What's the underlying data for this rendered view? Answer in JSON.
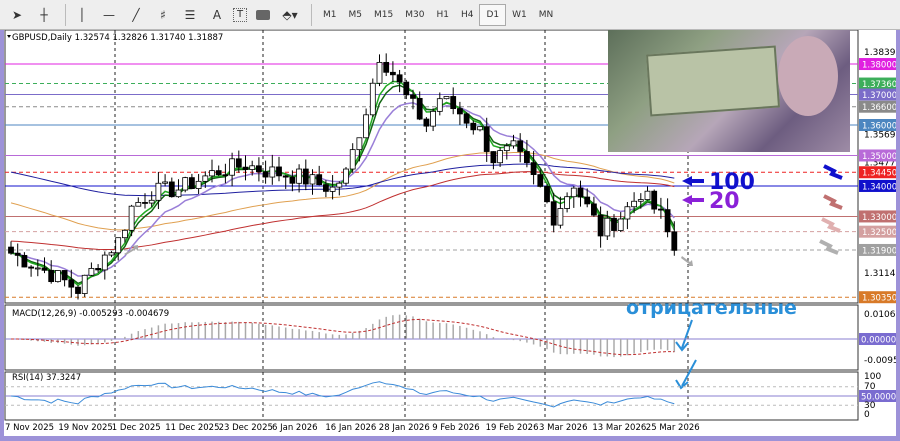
{
  "toolbar": {
    "tools": [
      "cursor-icon",
      "crosshair-icon",
      "vertical-line-icon",
      "horizontal-line-icon",
      "trendline-icon",
      "fibo-icon",
      "channel-icon",
      "text-icon",
      "text-label-icon",
      "rectangle-icon",
      "shapes-icon"
    ],
    "text_tool": "A",
    "text_label_tool": "T",
    "timeframes": [
      "M1",
      "M5",
      "M15",
      "M30",
      "H1",
      "H4",
      "D1",
      "W1",
      "MN"
    ],
    "active_timeframe": "D1"
  },
  "chart": {
    "symbol_header": "GBPUSD,Daily  1.32574 1.32826 1.31740 1.31887",
    "price_labels": [
      {
        "text": "1.38395",
        "p": 1.38395
      },
      {
        "text": "1.35695",
        "p": 1.35695
      },
      {
        "text": "1.34770",
        "p": 1.3477
      },
      {
        "text": "1.31145",
        "p": 1.31145
      }
    ],
    "levels": [
      {
        "text": "1.38000",
        "p": 1.38,
        "color": "#e020e0",
        "style": "solid"
      },
      {
        "text": "1.37360",
        "p": 1.3736,
        "color": "#3cae5a",
        "style": "dash"
      },
      {
        "text": "1.37000",
        "p": 1.37,
        "color": "#7b6cc9",
        "style": "solid"
      },
      {
        "text": "1.36600",
        "p": 1.366,
        "color": "#8a8a8a",
        "style": "dash"
      },
      {
        "text": "1.36000",
        "p": 1.36,
        "color": "#4c86c0",
        "style": "solid"
      },
      {
        "text": "1.35000",
        "p": 1.35,
        "color": "#b86ad8",
        "style": "solid"
      },
      {
        "text": "1.34450",
        "p": 1.3445,
        "color": "#ee2222",
        "style": "dash"
      },
      {
        "text": "1.34000",
        "p": 1.34,
        "color": "#1010cc",
        "style": "solid"
      },
      {
        "text": "1.33000",
        "p": 1.33,
        "color": "#c07070",
        "style": "solid"
      },
      {
        "text": "1.32500",
        "p": 1.325,
        "color": "#d4a0a0",
        "style": "dash"
      },
      {
        "text": "1.31900",
        "p": 1.319,
        "color": "#a0a0a0",
        "style": "dash"
      },
      {
        "text": "1.30350",
        "p": 1.3035,
        "color": "#d87a28",
        "style": "dash"
      }
    ],
    "waypoints": [
      [
        0,
        1.318
      ],
      [
        7,
        1.31
      ],
      [
        10,
        1.306
      ],
      [
        13,
        1.315
      ],
      [
        16,
        1.322
      ],
      [
        18,
        1.333
      ],
      [
        21,
        1.338
      ],
      [
        25,
        1.339
      ],
      [
        31,
        1.345
      ],
      [
        35,
        1.347
      ],
      [
        38,
        1.345
      ],
      [
        43,
        1.343
      ],
      [
        48,
        1.339
      ],
      [
        50,
        1.344
      ],
      [
        53,
        1.365
      ],
      [
        55,
        1.383
      ],
      [
        57,
        1.377
      ],
      [
        59,
        1.369
      ],
      [
        62,
        1.36
      ],
      [
        64,
        1.369
      ],
      [
        67,
        1.364
      ],
      [
        70,
        1.358
      ],
      [
        72,
        1.349
      ],
      [
        75,
        1.352
      ],
      [
        79,
        1.339
      ],
      [
        81,
        1.33
      ],
      [
        84,
        1.341
      ],
      [
        88,
        1.325
      ],
      [
        91,
        1.33
      ],
      [
        94,
        1.338
      ],
      [
        97,
        1.33
      ],
      [
        99,
        1.31887
      ]
    ],
    "annotations": {
      "ma100": "100",
      "ma20": "20",
      "negative": "отрицательные"
    },
    "colors": {
      "ma_fast": "#22aa22",
      "ma_mid": "#9a7fd8",
      "ma_slow": "#e0a050",
      "ma_red": "#c03030",
      "ma_blue": "#2020a0"
    }
  },
  "macd": {
    "header": "MACD(12,26,9) -0.005293 -0.004679",
    "top": "0.010635",
    "zero": "0.000000",
    "bottom": "-0.009536"
  },
  "rsi": {
    "header": "RSI(14) 37.3247",
    "l100": "100",
    "l70": "70",
    "l50": "50.0000",
    "l30": "30",
    "l0": "0"
  },
  "dates": [
    "7 Nov 2025",
    "19 Nov 2025",
    "1 Dec 2025",
    "11 Dec 2025",
    "23 Dec 2025",
    "6 Jan 2026",
    "16 Jan 2026",
    "28 Jan 2026",
    "9 Feb 2026",
    "19 Feb 2026",
    "3 Mar 2026",
    "13 Mar 2026",
    "25 Mar 2026"
  ]
}
